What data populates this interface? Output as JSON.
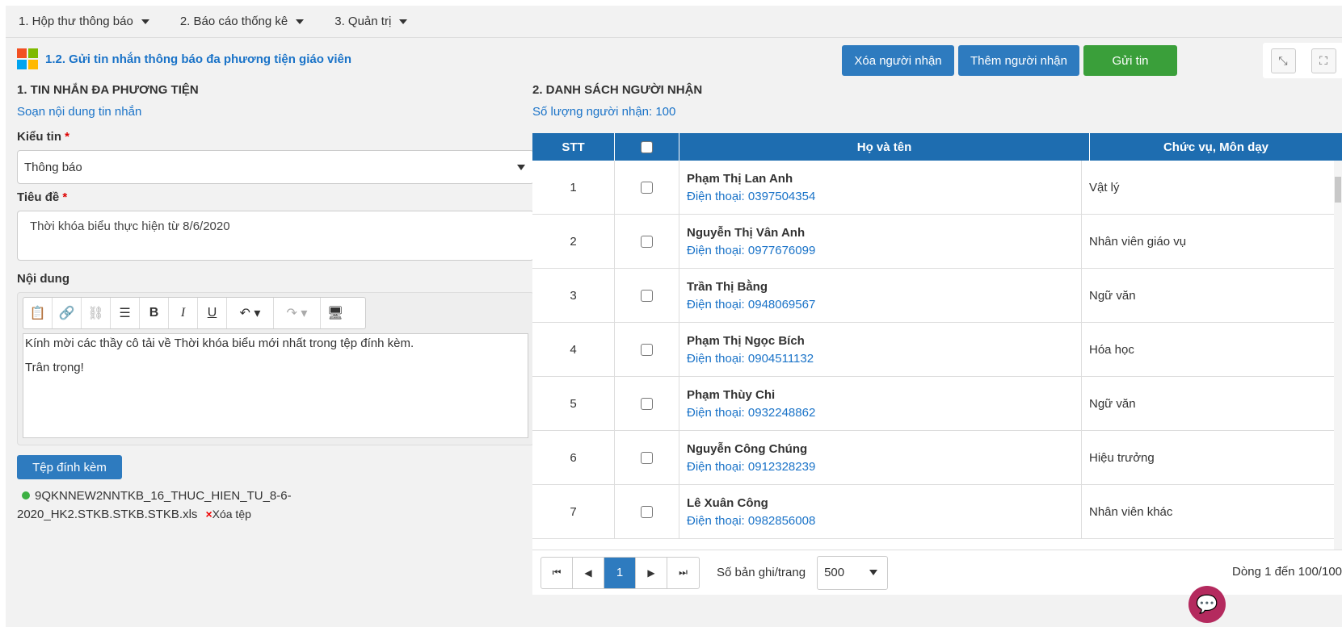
{
  "menu": {
    "items": [
      "1. Hộp thư thông báo",
      "2. Báo cáo thống kê",
      "3. Quản trị"
    ]
  },
  "header": {
    "title": "1.2. Gửi tin nhắn thông báo đa phương tiện giáo viên",
    "btn_delete": "Xóa người nhận",
    "btn_add": "Thêm người nhận",
    "btn_send": "Gửi tin",
    "colors": {
      "primary": "#2e7bbf",
      "success": "#3a9f3a"
    }
  },
  "left": {
    "section_title": "1. TIN NHẮN ĐA PHƯƠNG TIỆN",
    "compose_link": "Soạn nội dung tin nhắn",
    "type_label": "Kiểu tin",
    "type_value": "Thông báo",
    "subject_label": "Tiêu đề",
    "subject_value": "Thời khóa biểu thực hiện từ 8/6/2020",
    "content_label": "Nội dung",
    "content_lines": [
      "Kính mời các thầy cô tải về Thời khóa biểu mới nhất trong tệp đính kèm.",
      "Trân trọng!"
    ],
    "attach_button": "Tệp đính kèm",
    "file_name": "9QKNNEW2NNTKB_16_THUC_HIEN_TU_8-6-2020_HK2.STKB.STKB.STKB.xls",
    "delete_file": "Xóa tệp"
  },
  "right": {
    "section_title": "2. DANH SÁCH NGƯỜI NHẬN",
    "count_text": "Số lượng người nhận: 100",
    "columns": [
      "STT",
      "Họ và tên",
      "Chức vụ, Môn dạy"
    ],
    "rows": [
      {
        "stt": "1",
        "name": "Phạm Thị Lan Anh",
        "phone": "Điện thoại: 0397504354",
        "role": "Vật lý"
      },
      {
        "stt": "2",
        "name": "Nguyễn Thị Vân Anh",
        "phone": "Điện thoại: 0977676099",
        "role": "Nhân viên giáo vụ"
      },
      {
        "stt": "3",
        "name": "Trần Thị Bằng",
        "phone": "Điện thoại: 0948069567",
        "role": "Ngữ văn"
      },
      {
        "stt": "4",
        "name": "Phạm Thị Ngọc Bích",
        "phone": "Điện thoại: 0904511132",
        "role": "Hóa học"
      },
      {
        "stt": "5",
        "name": "Phạm Thùy Chi",
        "phone": "Điện thoại: 0932248862",
        "role": "Ngữ văn"
      },
      {
        "stt": "6",
        "name": "Nguyễn Công Chúng",
        "phone": "Điện thoại: 0912328239",
        "role": "Hiệu trưởng"
      },
      {
        "stt": "7",
        "name": "Lê Xuân Công",
        "phone": "Điện thoại: 0982856008",
        "role": "Nhân viên khác"
      }
    ],
    "pager": {
      "current_page": "1",
      "per_page_label": "Số bản ghi/trang",
      "per_page_value": "500",
      "summary": "Dòng 1 đến 100/100"
    }
  }
}
